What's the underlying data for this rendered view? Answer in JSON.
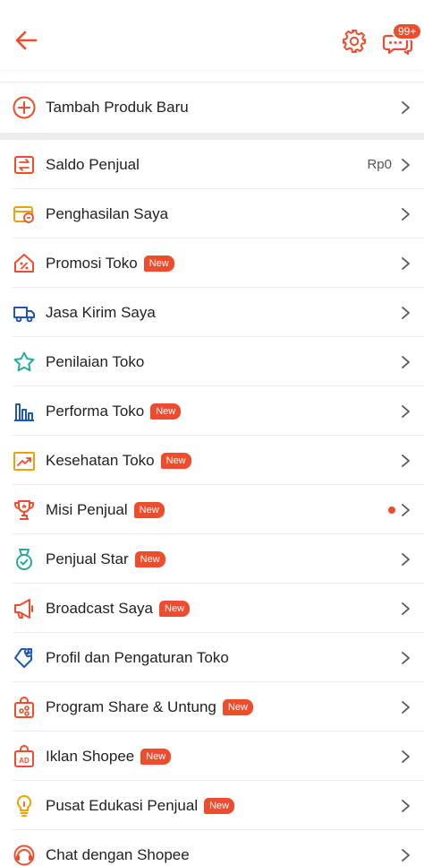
{
  "header": {
    "back_icon": "back-arrow-icon",
    "settings_icon": "gear-icon",
    "chat_icon": "chat-bubbles-icon",
    "chat_badge": "99+"
  },
  "add_product": {
    "label": "Tambah Produk Baru",
    "icon": "plus-circle-icon"
  },
  "new_tag": "New",
  "menu": [
    {
      "label": "Saldo Penjual",
      "icon": "wallet-transfer-icon",
      "value": "Rp0"
    },
    {
      "label": "Penghasilan Saya",
      "icon": "income-card-icon"
    },
    {
      "label": "Promosi Toko",
      "icon": "promo-tag-icon",
      "is_new": true
    },
    {
      "label": "Jasa Kirim Saya",
      "icon": "truck-icon"
    },
    {
      "label": "Penilaian Toko",
      "icon": "star-icon"
    },
    {
      "label": "Performa Toko",
      "icon": "bar-chart-icon",
      "is_new": true
    },
    {
      "label": "Kesehatan Toko",
      "icon": "trend-chart-icon",
      "is_new": true
    },
    {
      "label": "Misi Penjual",
      "icon": "trophy-icon",
      "is_new": true,
      "has_dot": true
    },
    {
      "label": "Penjual Star",
      "icon": "medal-icon",
      "is_new": true
    },
    {
      "label": "Broadcast Saya",
      "icon": "megaphone-icon",
      "is_new": true
    },
    {
      "label": "Profil dan Pengaturan Toko",
      "icon": "puzzle-icon"
    },
    {
      "label": "Program Share & Untung",
      "icon": "share-bag-icon",
      "is_new": true
    },
    {
      "label": "Iklan Shopee",
      "icon": "ad-bag-icon",
      "is_new": true
    },
    {
      "label": "Pusat Edukasi Penjual",
      "icon": "lightbulb-icon",
      "is_new": true
    },
    {
      "label": "Chat dengan Shopee",
      "icon": "chat-support-icon"
    }
  ],
  "colors": {
    "accent": "#ee4d2d",
    "blue": "#1d57b8",
    "teal": "#26aa99",
    "yellow": "#f0a000"
  }
}
